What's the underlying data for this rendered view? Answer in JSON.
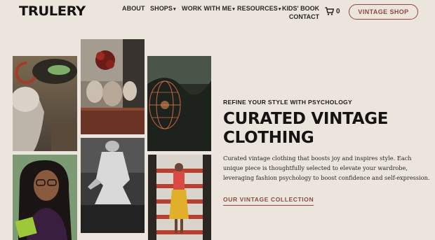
{
  "brand": {
    "logo_text": "TRULERY"
  },
  "nav": {
    "items": [
      {
        "label": "ABOUT",
        "has_dropdown": false
      },
      {
        "label": "SHOPS",
        "has_dropdown": true
      },
      {
        "label": "WORK WITH ME",
        "has_dropdown": true
      },
      {
        "label": "RESOURCES",
        "has_dropdown": true
      }
    ],
    "kids_book_line1": "KIDS' BOOK",
    "contact_label": "CONTACT",
    "cart_icon": "shopping-cart-icon",
    "cart_count": "0",
    "shop_button": "VINTAGE SHOP"
  },
  "hero": {
    "eyebrow": "REFINE YOUR STYLE WITH PSYCHOLOGY",
    "headline_line1": "CURATED VINTAGE",
    "headline_line2": "CLOTHING",
    "description": "Curated vintage clothing that boosts joy and inspires style. Each unique piece is thoughtfully selected to elevate your wardrobe, leveraging fashion psychology to boost confidence and self-expression.",
    "cta": "OUR VINTAGE COLLECTION"
  },
  "colors": {
    "background": "#ebe5dd",
    "accent": "#8c4a3f",
    "text": "#1e1b18"
  }
}
